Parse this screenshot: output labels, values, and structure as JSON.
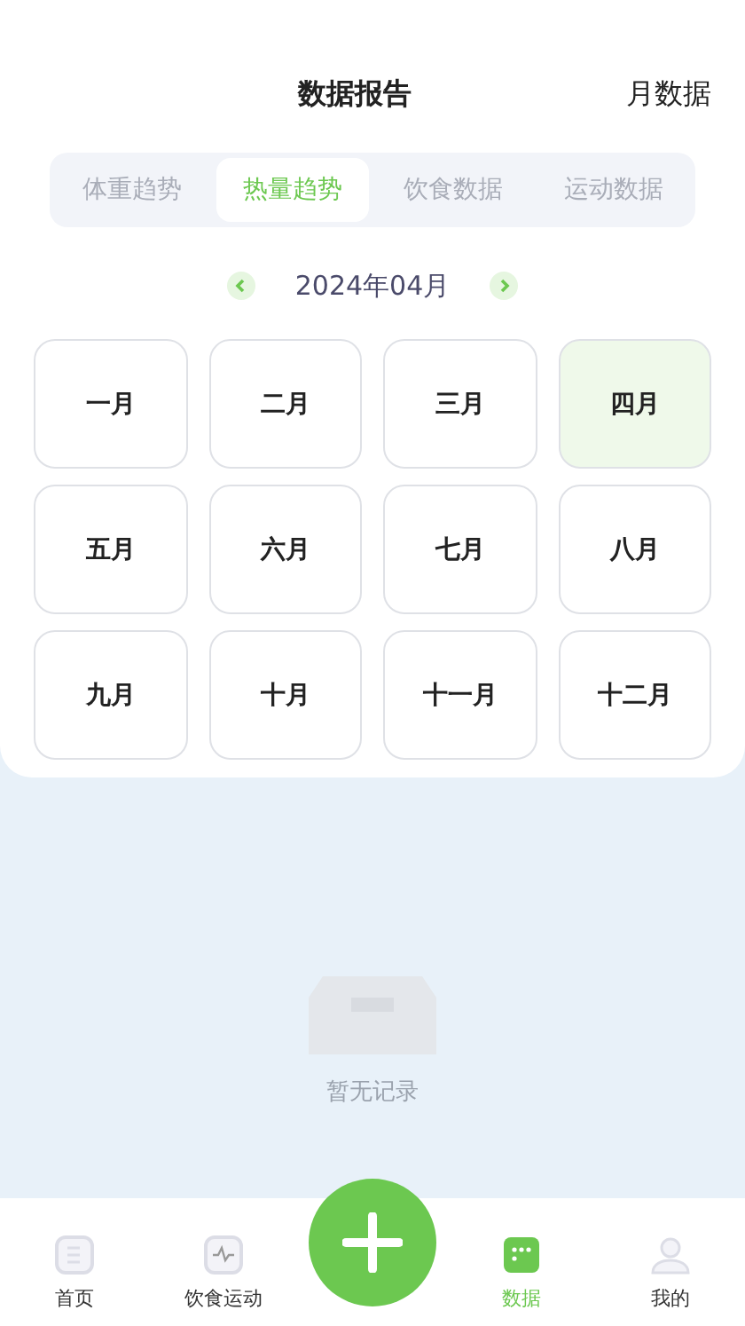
{
  "header": {
    "title": "数据报告",
    "action": "月数据"
  },
  "tabs": [
    {
      "label": "体重趋势",
      "selected": false
    },
    {
      "label": "热量趋势",
      "selected": true
    },
    {
      "label": "饮食数据",
      "selected": false
    },
    {
      "label": "运动数据",
      "selected": false
    }
  ],
  "month_nav": {
    "label": "2024年04月"
  },
  "months": [
    {
      "label": "一月",
      "selected": false
    },
    {
      "label": "二月",
      "selected": false
    },
    {
      "label": "三月",
      "selected": false
    },
    {
      "label": "四月",
      "selected": true
    },
    {
      "label": "五月",
      "selected": false
    },
    {
      "label": "六月",
      "selected": false
    },
    {
      "label": "七月",
      "selected": false
    },
    {
      "label": "八月",
      "selected": false
    },
    {
      "label": "九月",
      "selected": false
    },
    {
      "label": "十月",
      "selected": false
    },
    {
      "label": "十一月",
      "selected": false
    },
    {
      "label": "十二月",
      "selected": false
    }
  ],
  "empty_state": {
    "text": "暂无记录"
  },
  "bottom_nav": [
    {
      "kind": "home",
      "label": "首页",
      "selected": false
    },
    {
      "kind": "food",
      "label": "饮食运动",
      "selected": false
    },
    {
      "kind": "add"
    },
    {
      "kind": "data",
      "label": "数据",
      "selected": true
    },
    {
      "kind": "profile",
      "label": "我的",
      "selected": false
    }
  ]
}
